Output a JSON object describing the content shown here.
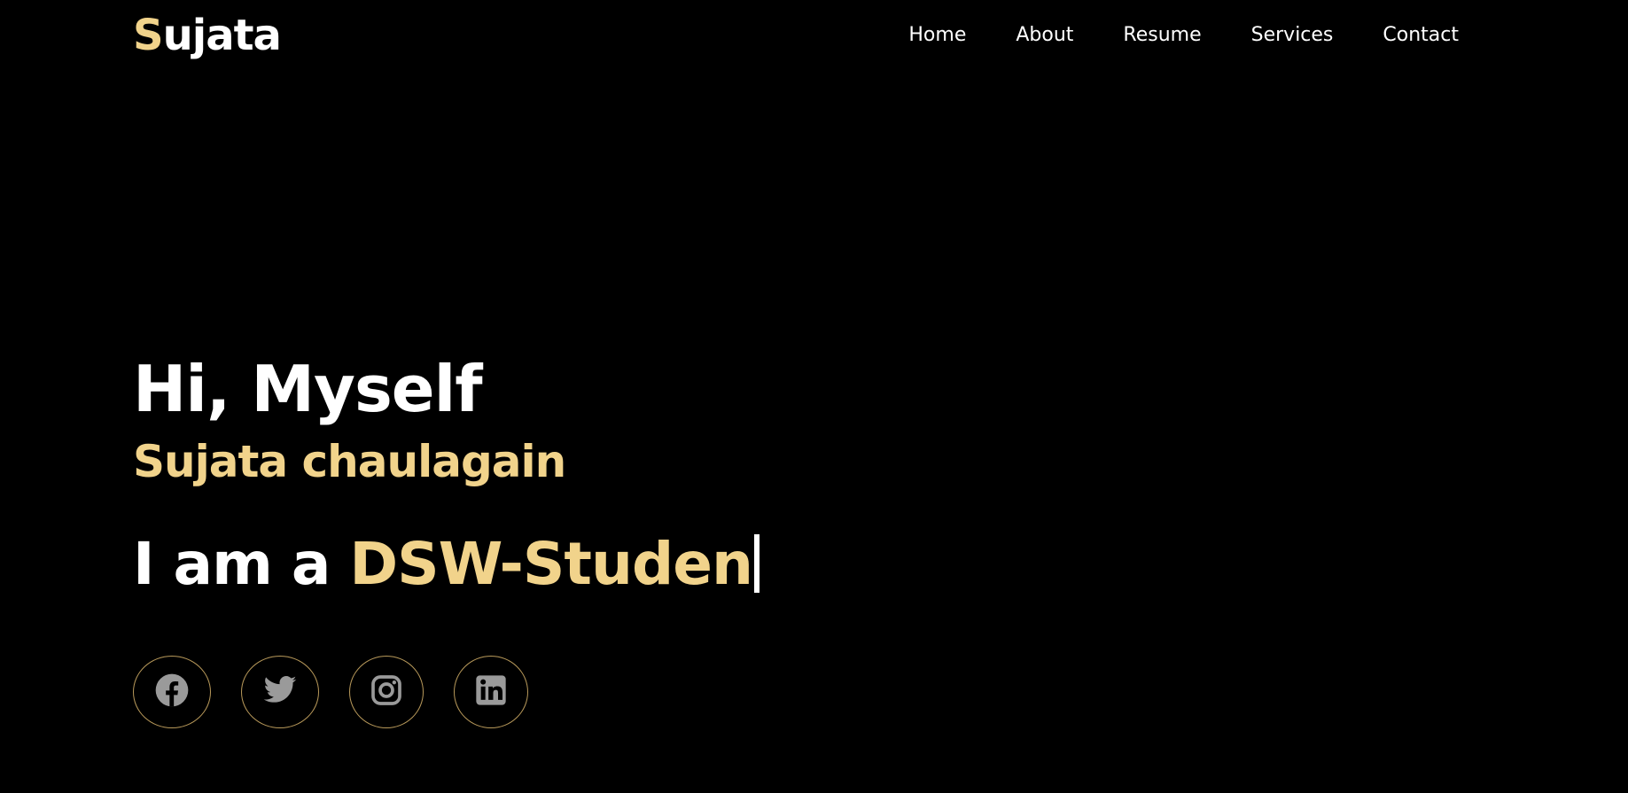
{
  "logo": {
    "initial": "S",
    "rest": "ujata"
  },
  "nav": {
    "items": [
      {
        "label": "Home"
      },
      {
        "label": "About"
      },
      {
        "label": "Resume"
      },
      {
        "label": "Services"
      },
      {
        "label": "Contact"
      }
    ]
  },
  "hero": {
    "greeting": "Hi, Myself",
    "name": "Sujata chaulagain",
    "role_prefix": "I am a ",
    "role_typed": "DSW-Studen"
  },
  "socials": [
    {
      "icon": "facebook-icon"
    },
    {
      "icon": "twitter-icon"
    },
    {
      "icon": "instagram-icon"
    },
    {
      "icon": "linkedin-icon"
    }
  ],
  "colors": {
    "background": "#000000",
    "text": "#ffffff",
    "accent": "#f1d38b",
    "social_border": "#b8995a",
    "social_icon": "#9a9a9a"
  }
}
